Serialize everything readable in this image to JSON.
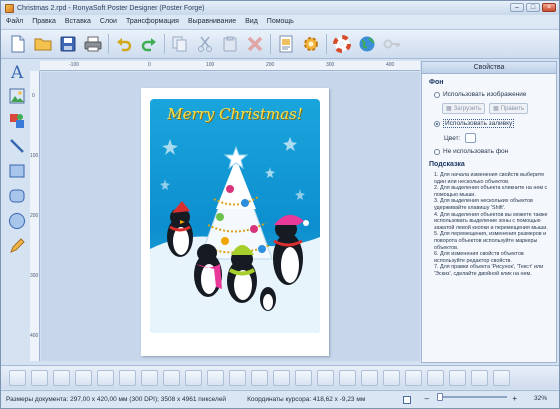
{
  "window": {
    "title": "Christmas 2.rpd - RonyaSoft Poster Designer (Poster Forge)"
  },
  "menu": [
    "Файл",
    "Правка",
    "Вставка",
    "Слои",
    "Трансформация",
    "Выравнивание",
    "Вид",
    "Помощь"
  ],
  "toolbar": {
    "groups": [
      [
        "new-document-icon",
        "open-folder-icon",
        "save-icon",
        "print-icon"
      ],
      [
        "undo-icon",
        "redo-icon"
      ],
      [
        "copy-icon",
        "cut-icon",
        "paste-icon",
        "delete-icon"
      ],
      [
        "page-setup-icon",
        "settings-gear-icon"
      ],
      [
        "help-lifebuoy-icon",
        "web-globe-icon",
        "registration-key-icon"
      ]
    ]
  },
  "tools": [
    "text-tool-icon",
    "image-tool-icon",
    "clipart-tool-icon",
    "line-tool-icon",
    "rectangle-tool-icon",
    "rounded-rectangle-tool-icon",
    "ellipse-tool-icon",
    "pencil-tool-icon"
  ],
  "ruler": {
    "top": [
      "-100",
      "0",
      "100",
      "200",
      "300",
      "400"
    ],
    "left": [
      "0",
      "100",
      "200",
      "300",
      "400"
    ]
  },
  "poster": {
    "greeting": "Merry Christmas!"
  },
  "panel": {
    "title": "Свойства",
    "background_section": "Фон",
    "use_image": "Использовать изображение",
    "load_button": "Загрузить",
    "edit_button": "Править",
    "use_fill": "Использовать заливку",
    "color_label": "Цвет:",
    "no_background": "Не использовать фон",
    "hint_section": "Подсказка",
    "hints": [
      "1. Для начала изменения свойств выберите один или несколько объектов.",
      "2. Для выделения объекта кликните на нем с помощью мыши.",
      "3. Для выделения нескольких объектов удерживайте клавишу 'Shift'.",
      "4. Для выделения объектов вы можете также использовать выделение зоны с помощью зажатой левой кнопки и перемещения мыши.",
      "5. Для перемещения, изменения размеров и поворота объектов используйте маркеры объектов.",
      "6. Для изменения свойств объектов используйте редактор свойств.",
      "7. Для правки объекта 'Рисунок', 'Текст' или 'Эскиз', сделайте двойной клик на нем."
    ]
  },
  "status": {
    "doc_size": "Размеры документа: 297,00 x 420,00 мм (300 DPI); 3508 x 4961 пикселей",
    "cursor": "Координаты курсора: 418,62 x -9,23 мм",
    "zoom": "32%"
  },
  "colors": {
    "poster_bg": "#0d8fcf",
    "greeting": "#f8e04a",
    "accent": "#2a4f86"
  }
}
